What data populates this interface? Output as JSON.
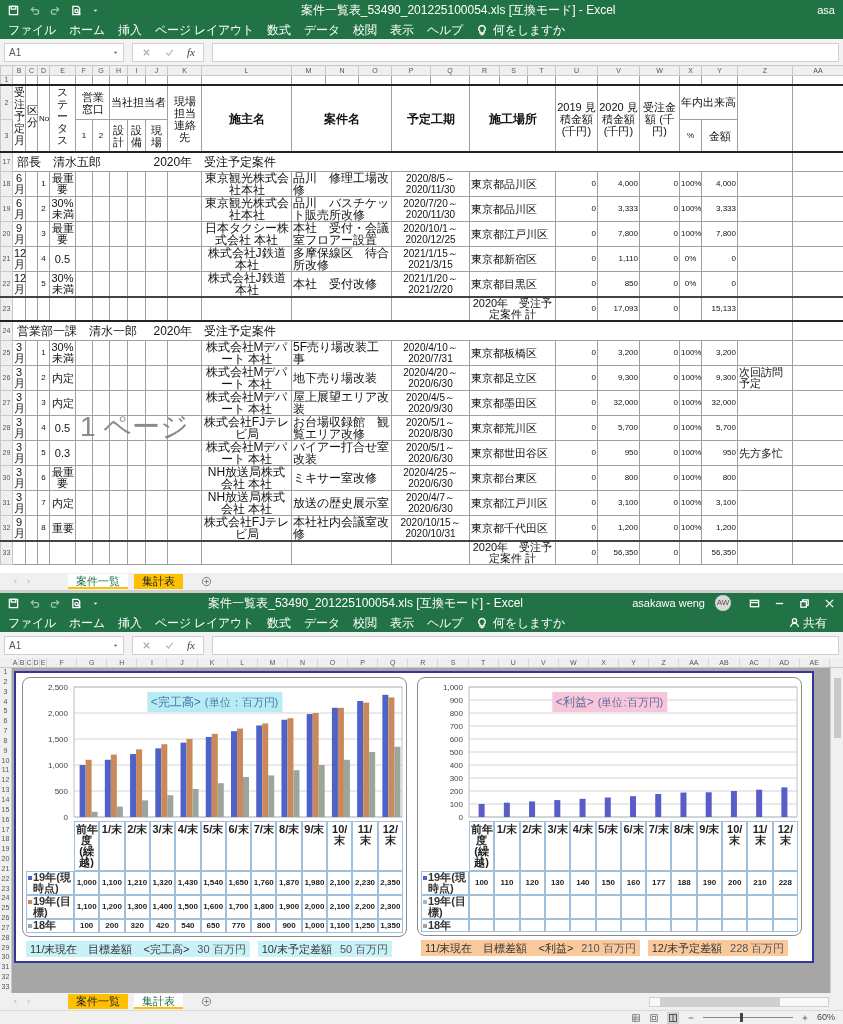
{
  "top_window": {
    "title_bar": {
      "title": "案件一覧表_53490_201225100054.xls  [互換モード]  -  Excel",
      "user": "asa"
    },
    "menu": {
      "items": [
        "ファイル",
        "ホーム",
        "挿入",
        "ページ レイアウト",
        "数式",
        "データ",
        "校閲",
        "表示",
        "ヘルプ"
      ],
      "tell_me": "何をしますか"
    },
    "formula_bar": {
      "name_box": "A1",
      "fx": "fx"
    },
    "sheet": {
      "column_letters": [
        "B",
        "C",
        "D",
        "E",
        "F",
        "G",
        "H",
        "I",
        "J",
        "K",
        "L",
        "M",
        "N",
        "O",
        "P",
        "Q",
        "R",
        "S",
        "T",
        "U",
        "V",
        "W",
        "X",
        "Y",
        "Z",
        "AA"
      ],
      "header_row_numbers": [
        "1",
        "2",
        "3"
      ],
      "header": {
        "month": "受注予定月",
        "category": "区分",
        "no": "No",
        "status": "ステータス",
        "sales": "営業窓口",
        "sales_1": "1",
        "sales_2": "2",
        "staff": "当社担当者",
        "staff_design": "設計",
        "staff_equipment": "設備",
        "staff_site": "現場",
        "site_contact": "現場担当連絡先",
        "client": "施主名",
        "project": "案件名",
        "period": "予定工期",
        "location": "施工場所",
        "est_2019": "2019 見積金額 (千円)",
        "est_2020": "2020 見積金額 (千円)",
        "order": "受注金額 (千円)",
        "progress": "年内出来高",
        "progress_pct": "%",
        "progress_amount": "金額"
      },
      "sections": [
        {
          "row_number": "17",
          "title": "部長　清水五郎",
          "subtitle": "2020年　受注予定案件",
          "rows": [
            {
              "row_number": "18",
              "month": "6月",
              "no": "1",
              "status": "最重要",
              "client": "東京観光株式会社本社",
              "project": "品川　修理工場改修",
              "period": "2020/8/5～2020/11/30",
              "location": "東京都品川区",
              "est_2019": "0",
              "est_2020": "4,000",
              "order": "0",
              "pct": "100%",
              "amount": "4,000"
            },
            {
              "row_number": "19",
              "month": "6月",
              "no": "2",
              "status": "30%未満",
              "client": "東京観光株式会社本社",
              "project": "品川　バスチケット販売所改修",
              "period": "2020/7/20～2020/11/30",
              "location": "東京都品川区",
              "est_2019": "0",
              "est_2020": "3,333",
              "order": "0",
              "pct": "100%",
              "amount": "3,333"
            },
            {
              "row_number": "20",
              "month": "9月",
              "no": "3",
              "status": "最重要",
              "client": "日本タクシー株式会社 本社",
              "project": "本社　受付・会議室フロアー設置",
              "period": "2020/10/1～2020/12/25",
              "location": "東京都江戸川区",
              "est_2019": "0",
              "est_2020": "7,800",
              "order": "0",
              "pct": "100%",
              "amount": "7,800"
            },
            {
              "row_number": "21",
              "month": "12月",
              "no": "4",
              "status": "0.5",
              "client": "株式会社J鉄道本社",
              "project": "多摩保線区　待合所改修",
              "period": "2021/1/15～2021/3/15",
              "location": "東京都新宿区",
              "est_2019": "0",
              "est_2020": "1,110",
              "order": "0",
              "pct": "0%",
              "amount": "0"
            },
            {
              "row_number": "22",
              "month": "12月",
              "no": "5",
              "status": "30%未満",
              "client": "株式会社J鉄道本社",
              "project": "本社　受付改修",
              "period": "2021/1/20～2021/2/20",
              "location": "東京都目黒区",
              "est_2019": "0",
              "est_2020": "850",
              "order": "0",
              "pct": "0%",
              "amount": "0"
            }
          ],
          "total": {
            "row_number": "23",
            "label": "2020年　受注予定案件 計",
            "est_2019": "0",
            "est_2020": "17,093",
            "order": "0",
            "amount": "15,133"
          }
        },
        {
          "row_number": "24",
          "title": "営業部一課　清水一郎",
          "subtitle": "2020年　受注予定案件",
          "rows": [
            {
              "row_number": "25",
              "month": "3月",
              "no": "1",
              "status": "30%未満",
              "client": "株式会社Mデパート 本社",
              "project": "5F売り場改装工事",
              "period": "2020/4/10～2020/7/31",
              "location": "東京都板橋区",
              "est_2019": "0",
              "est_2020": "3,200",
              "order": "0",
              "pct": "100%",
              "amount": "3,200"
            },
            {
              "row_number": "26",
              "month": "3月",
              "no": "2",
              "status": "内定",
              "client": "株式会社Mデパート 本社",
              "project": "地下売り場改装",
              "period": "2020/4/20～2020/6/30",
              "location": "東京都足立区",
              "est_2019": "0",
              "est_2020": "9,300",
              "order": "0",
              "pct": "100%",
              "amount": "9,300",
              "note": "次回訪問予定"
            },
            {
              "row_number": "27",
              "month": "3月",
              "no": "3",
              "status": "内定",
              "client": "株式会社Mデパート 本社",
              "project": "屋上展望エリア改装",
              "period": "2020/4/5～2020/9/30",
              "location": "東京都墨田区",
              "est_2019": "0",
              "est_2020": "32,000",
              "order": "0",
              "pct": "100%",
              "amount": "32,000"
            },
            {
              "row_number": "28",
              "month": "3月",
              "no": "4",
              "status": "0.5",
              "client": "株式会社FJテレビ局",
              "project": "お台場収録館　観覧エリア改修",
              "period": "2020/5/1～2020/8/30",
              "location": "東京都荒川区",
              "est_2019": "0",
              "est_2020": "5,700",
              "order": "0",
              "pct": "100%",
              "amount": "5,700"
            },
            {
              "row_number": "29",
              "month": "3月",
              "no": "5",
              "status": "0.3",
              "client": "株式会社Mデパート 本社",
              "project": "バイアー打合せ室改装",
              "period": "2020/5/1～2020/6/30",
              "location": "東京都世田谷区",
              "est_2019": "0",
              "est_2020": "950",
              "order": "0",
              "pct": "100%",
              "amount": "950",
              "note": "先方多忙"
            },
            {
              "row_number": "30",
              "month": "3月",
              "no": "6",
              "status": "最重要",
              "client": "NH放送局株式会社 本社",
              "project": "ミキサー室改修",
              "period": "2020/4/25～2020/6/30",
              "location": "東京都台東区",
              "est_2019": "0",
              "est_2020": "800",
              "order": "0",
              "pct": "100%",
              "amount": "800"
            },
            {
              "row_number": "31",
              "month": "3月",
              "no": "7",
              "status": "内定",
              "client": "NH放送局株式会社 本社",
              "project": "放送の歴史展示室",
              "period": "2020/4/7～2020/6/30",
              "location": "東京都江戸川区",
              "est_2019": "0",
              "est_2020": "3,100",
              "order": "0",
              "pct": "100%",
              "amount": "3,100"
            },
            {
              "row_number": "32",
              "month": "9月",
              "no": "8",
              "status": "重要",
              "client": "株式会社FJテレビ局",
              "project": "本社社内会議室改修",
              "period": "2020/10/15～2020/10/31",
              "location": "東京都千代田区",
              "est_2019": "0",
              "est_2020": "1,200",
              "order": "0",
              "pct": "100%",
              "amount": "1,200"
            }
          ],
          "total": {
            "row_number": "33",
            "label": "2020年　受注予定案件 計",
            "est_2019": "0",
            "est_2020": "56,350",
            "order": "0",
            "amount": "56,350"
          }
        }
      ],
      "page_label": "1 ページ"
    },
    "sheet_tabs": [
      {
        "label": "案件一覧",
        "selected": true,
        "color": "#ffc000"
      },
      {
        "label": "集計表",
        "selected": false,
        "color": "#ffc000"
      }
    ]
  },
  "bottom_window": {
    "title_bar": {
      "title": "案件一覧表_53490_201225100054.xls  [互換モード]  -  Excel",
      "user": "asakawa weng",
      "avatar": "AW",
      "window_controls": true
    },
    "menu": {
      "items": [
        "ファイル",
        "ホーム",
        "挿入",
        "ページ レイアウト",
        "数式",
        "データ",
        "校閲",
        "表示",
        "ヘルプ"
      ],
      "tell_me": "何をしますか",
      "share": "共有"
    },
    "formula_bar": {
      "name_box": "A1",
      "fx": "fx"
    },
    "sheet": {
      "column_letters": [
        "A",
        "B",
        "C",
        "D",
        "E",
        "F",
        "G",
        "H",
        "I",
        "J",
        "K",
        "L",
        "M",
        "N",
        "O",
        "P",
        "Q",
        "R",
        "S",
        "T",
        "U",
        "V",
        "W",
        "X",
        "Y",
        "Z",
        "AA",
        "AB",
        "AC",
        "AD",
        "AE"
      ],
      "row_numbers": [
        "1",
        "2",
        "3",
        "4",
        "5",
        "6",
        "7",
        "8",
        "9",
        "10",
        "11",
        "12",
        "13",
        "14",
        "15",
        "16",
        "17",
        "18",
        "19",
        "20",
        "21",
        "22",
        "23",
        "24",
        "25",
        "26",
        "27",
        "28",
        "29",
        "30",
        "31",
        "32",
        "33"
      ],
      "charts": [
        {
          "unit": "(単位：百万円)",
          "title_panel": {
            "color": "#b8ecf5"
          },
          "color": "#c9f1f8",
          "chart_data": {
            "type": "bar",
            "title": "<完工高>",
            "categories": [
              "前年度(繰越)",
              "1/末",
              "2/末",
              "3/末",
              "4/末",
              "5/末",
              "6/末",
              "7/末",
              "8/末",
              "9/末",
              "10/末",
              "11/末",
              "12/末"
            ],
            "series": [
              {
                "name": "19年(現時点)",
                "color": "#4e62c8",
                "values": [
                  1000,
                  1100,
                  1210,
                  1320,
                  1430,
                  1540,
                  1650,
                  1760,
                  1870,
                  1980,
                  2100,
                  2230,
                  2350
                ]
              },
              {
                "name": "19年(目標)",
                "color": "#c9895a",
                "values": [
                  1100,
                  1200,
                  1300,
                  1400,
                  1500,
                  1600,
                  1700,
                  1800,
                  1900,
                  2000,
                  2100,
                  2200,
                  2300
                ]
              },
              {
                "name": "18年",
                "color": "#9ba59c",
                "values": [
                  100,
                  200,
                  320,
                  420,
                  540,
                  650,
                  770,
                  800,
                  900,
                  1000,
                  1100,
                  1250,
                  1350
                ]
              }
            ],
            "ylim": [
              0,
              2500
            ],
            "yticks": [
              {
                "value": 0,
                "label": "0"
              },
              {
                "value": 500,
                "label": "500"
              },
              {
                "value": 1000,
                "label": "1,000"
              },
              {
                "value": 1500,
                "label": "1,500"
              },
              {
                "value": 2000,
                "label": "2,000"
              },
              {
                "value": 2500,
                "label": "2,500"
              }
            ],
            "grid": true,
            "legend": "left"
          },
          "data_table": [
            [
              "1,000",
              "1,100",
              "1,210",
              "1,320",
              "1,430",
              "1,540",
              "1,650",
              "1,760",
              "1,870",
              "1,980",
              "2,100",
              "2,230",
              "2,350"
            ],
            [
              "1,100",
              "1,200",
              "1,300",
              "1,400",
              "1,500",
              "1,600",
              "1,700",
              "1,800",
              "1,900",
              "2,000",
              "2,100",
              "2,200",
              "2,300"
            ],
            [
              "100",
              "200",
              "320",
              "420",
              "540",
              "650",
              "770",
              "800",
              "900",
              "1,000",
              "1,100",
              "1,250",
              "1,350"
            ]
          ],
          "summaries": [
            {
              "label": "11/末現在　目標差額　<完工高>",
              "value": "30 百万円"
            },
            {
              "label": "10/末予定差額",
              "value": "50 百万円"
            }
          ]
        },
        {
          "unit": "(単位:百万円)",
          "title_panel": {
            "color": "#f7c6d9"
          },
          "color": "#f9c99c",
          "chart_data": {
            "type": "bar",
            "title": "<利益>",
            "categories": [
              "前年度(繰越)",
              "1/末",
              "2/末",
              "3/末",
              "4/末",
              "5/末",
              "6/末",
              "7/末",
              "8/末",
              "9/末",
              "10/末",
              "11/末",
              "12/末"
            ],
            "series": [
              {
                "name": "19年(現時点)",
                "color": "#5a5cc8",
                "values": [
                  100,
                  110,
                  120,
                  130,
                  140,
                  150,
                  160,
                  177,
                  188,
                  190,
                  200,
                  210,
                  228
                ]
              },
              {
                "name": "19年(目標)",
                "color": "#9fb7d8",
                "values": [
                  null,
                  null,
                  null,
                  null,
                  null,
                  null,
                  null,
                  null,
                  null,
                  null,
                  null,
                  null,
                  null
                ]
              },
              {
                "name": "18年",
                "color": "#9ba59c",
                "values": [
                  null,
                  null,
                  null,
                  null,
                  null,
                  null,
                  null,
                  null,
                  null,
                  null,
                  null,
                  null,
                  null
                ]
              }
            ],
            "ylim": [
              0,
              1000
            ],
            "yticks": [
              {
                "value": 0,
                "label": "0"
              },
              {
                "value": 100,
                "label": "100"
              },
              {
                "value": 200,
                "label": "200"
              },
              {
                "value": 300,
                "label": "300"
              },
              {
                "value": 400,
                "label": "400"
              },
              {
                "value": 500,
                "label": "500"
              },
              {
                "value": 600,
                "label": "600"
              },
              {
                "value": 700,
                "label": "700"
              },
              {
                "value": 800,
                "label": "800"
              },
              {
                "value": 900,
                "label": "900"
              },
              {
                "value": 1000,
                "label": "1,000"
              }
            ],
            "grid": true,
            "legend": "left"
          },
          "data_table": [
            [
              "100",
              "110",
              "120",
              "130",
              "140",
              "150",
              "160",
              "177",
              "188",
              "190",
              "200",
              "210",
              "228"
            ]
          ],
          "summaries": [
            {
              "label": "11/末現在　目標差額　<利益>",
              "value": "210 百万円"
            },
            {
              "label": "12/末予定差額",
              "value": "228 百万円"
            }
          ]
        }
      ]
    },
    "sheet_tabs": [
      {
        "label": "案件一覧",
        "selected": false,
        "color": "#ffc000"
      },
      {
        "label": "集計表",
        "selected": true,
        "color": "#ffc000"
      }
    ],
    "status_bar": {
      "zoom": {
        "level": 0.42,
        "reading": "60%"
      }
    }
  }
}
